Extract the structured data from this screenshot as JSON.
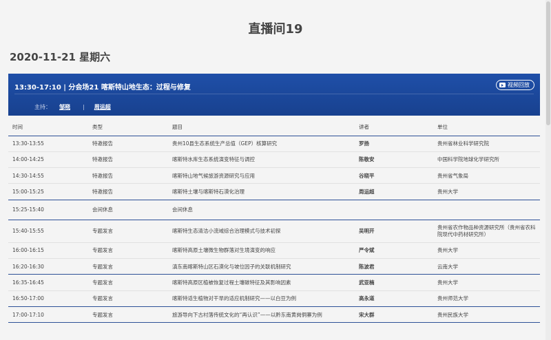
{
  "page": {
    "title": "直播间19",
    "date": "2020-11-21 星期六"
  },
  "session": {
    "title": "13:30-17:10 | 分会场21 喀斯特山地生态：过程与修复",
    "replay_label": "视频回放",
    "replay_icon": "video-play-icon",
    "host_label": "主持：",
    "hosts": [
      "邹晓",
      "周运超"
    ],
    "color": "#1f4fa8"
  },
  "table": {
    "headers": [
      "时间",
      "类型",
      "题目",
      "讲者",
      "单位"
    ],
    "rows": [
      {
        "time": "13:30-13:55",
        "type": "特邀报告",
        "topic": "贵州10县生态系统生产总值（GEP）核算研究",
        "speaker": "罗扬",
        "unit": "贵州省林业科学研究院"
      },
      {
        "time": "14:00-14:25",
        "type": "特邀报告",
        "topic": "喀斯特水库生态系统演变特征与调控",
        "speaker": "陈敬安",
        "unit": "中国科学院地球化学研究所"
      },
      {
        "time": "14:30-14:55",
        "type": "特邀报告",
        "topic": "喀斯特山地气候旅游资源研究与应用",
        "speaker": "谷晓平",
        "unit": "贵州省气象局"
      },
      {
        "time": "15:00-15:25",
        "type": "特邀报告",
        "topic": "喀斯特土壤与喀斯特石漠化治理",
        "speaker": "周运超",
        "unit": "贵州大学"
      },
      {
        "time": "15:25-15:40",
        "type": "会间休息",
        "topic": "会间休息",
        "speaker": "",
        "unit": ""
      },
      {
        "time": "15:40-15:55",
        "type": "专题发言",
        "topic": "喀斯特生态清洁小流域综合治理模式与技术初探",
        "speaker": "吴明开",
        "unit": "贵州省农作物品种资源研究所（贵州省农科院现代中药材研究所）"
      },
      {
        "time": "16:00-16:15",
        "type": "专题发言",
        "topic": "喀斯特高原土壤微生物群落对生境演变的响应",
        "speaker": "严令斌",
        "unit": "贵州大学"
      },
      {
        "time": "16:20-16:30",
        "type": "专题发言",
        "topic": "滇东南喀斯特山区石漠化与坡位因子的关联机制研究",
        "speaker": "陈波君",
        "unit": "云南大学"
      },
      {
        "time": "16:35-16:45",
        "type": "专题发言",
        "topic": "喀斯特高原区植被恢复过程土壤碳特征及其影响因素",
        "speaker": "武亚楠",
        "unit": "贵州大学"
      },
      {
        "time": "16:50-17:00",
        "type": "专题发言",
        "topic": "喀斯特适生植物对干旱的适应机制研究——以白豆为例",
        "speaker": "高永道",
        "unit": "贵州师范大学"
      },
      {
        "time": "17:00-17:10",
        "type": "专题发言",
        "topic": "旅游导向下古村落传统文化的“再认识”——以黔东南黄岗侗寨为例",
        "speaker": "宋大群",
        "unit": "贵州民族大学"
      }
    ]
  }
}
